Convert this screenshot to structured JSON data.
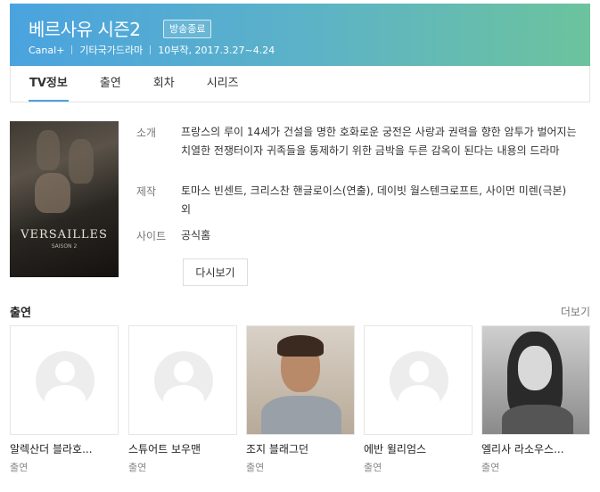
{
  "header": {
    "title": "베르사유 시즌2",
    "badge": "방송종료",
    "meta": [
      "Canal+",
      "기타국가드라마",
      "10부작, 2017.3.27~4.24"
    ],
    "gradient_start": "#4aa3df",
    "gradient_end": "#6cc39d"
  },
  "tabs": [
    {
      "label": "TV정보",
      "active": true
    },
    {
      "label": "출연",
      "active": false
    },
    {
      "label": "회차",
      "active": false
    },
    {
      "label": "시리즈",
      "active": false
    }
  ],
  "poster": {
    "title": "VERSAILLES",
    "subtitle": "SAISON 2"
  },
  "info": {
    "intro_label": "소개",
    "intro_text": "프랑스의 루이 14세가 건설을 명한 호화로운 궁전은 사랑과 권력을 향한 암투가 벌어지는 치열한 전쟁터이자 귀족들을 통제하기 위한 금박을 두른 감옥이 된다는 내용의 드라마",
    "production_label": "제작",
    "production_text": "토마스 빈센트, 크리스찬 핸글로이스(연출), 데이빗 월스텐크로프트, 사이먼 미렌(극본) 외",
    "site_label": "사이트",
    "site_text": "공식홈"
  },
  "rewatch_button": "다시보기",
  "cast_section": {
    "title": "출연",
    "more": "더보기",
    "members": [
      {
        "name": "알렉산더 블라호...",
        "role": "출연",
        "photo": "placeholder"
      },
      {
        "name": "스튜어트 보우맨",
        "role": "출연",
        "photo": "placeholder"
      },
      {
        "name": "조지 블래그던",
        "role": "출연",
        "photo": "photo"
      },
      {
        "name": "에반 윌리엄스",
        "role": "출연",
        "photo": "placeholder"
      },
      {
        "name": "엘리사 라소우스...",
        "role": "출연",
        "photo": "photo"
      }
    ]
  }
}
